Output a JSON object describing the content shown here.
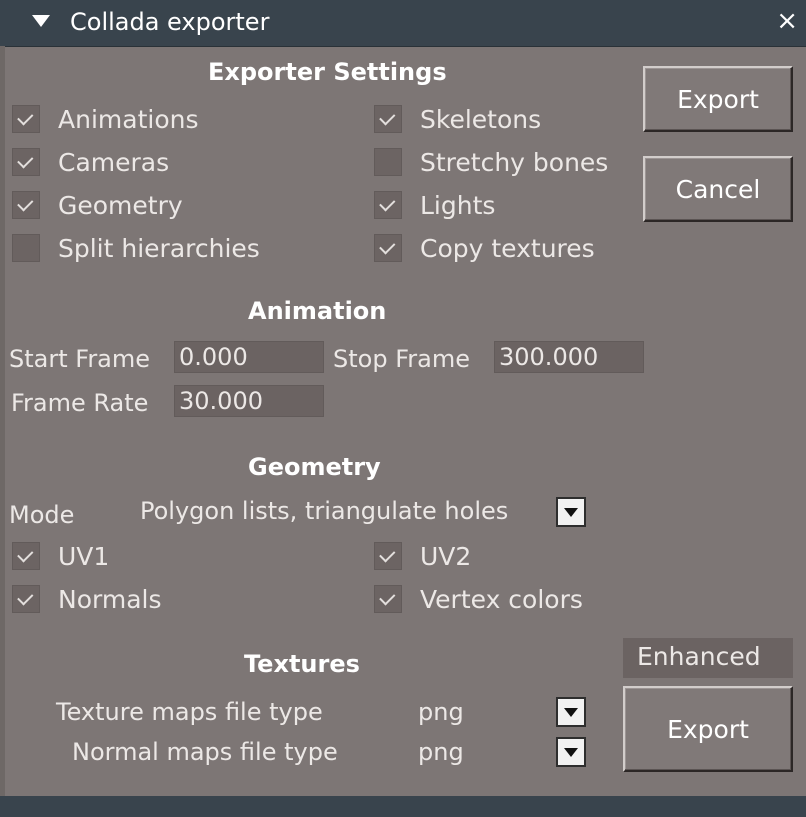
{
  "window": {
    "title": "Collada exporter",
    "close_glyph": "×"
  },
  "exporter_settings": {
    "heading": "Exporter Settings",
    "options": [
      {
        "label": "Animations",
        "checked": true
      },
      {
        "label": "Cameras",
        "checked": true
      },
      {
        "label": "Geometry",
        "checked": true
      },
      {
        "label": "Split hierarchies",
        "checked": false
      },
      {
        "label": "Skeletons",
        "checked": true
      },
      {
        "label": "Stretchy bones",
        "checked": false
      },
      {
        "label": "Lights",
        "checked": true
      },
      {
        "label": "Copy textures",
        "checked": true
      }
    ]
  },
  "buttons": {
    "export": "Export",
    "cancel": "Cancel",
    "enhanced_export": "Export"
  },
  "animation": {
    "heading": "Animation",
    "start_frame_label": "Start Frame",
    "start_frame_value": "0.000",
    "stop_frame_label": "Stop Frame",
    "stop_frame_value": "300.000",
    "frame_rate_label": "Frame Rate",
    "frame_rate_value": "30.000"
  },
  "geometry": {
    "heading": "Geometry",
    "mode_label": "Mode",
    "mode_value": "Polygon lists, triangulate holes",
    "options": [
      {
        "label": "UV1",
        "checked": true
      },
      {
        "label": "Normals",
        "checked": true
      },
      {
        "label": "UV2",
        "checked": true
      },
      {
        "label": "Vertex colors",
        "checked": true
      }
    ]
  },
  "textures": {
    "heading": "Textures",
    "texture_maps_label": "Texture maps file type",
    "texture_maps_value": "png",
    "normal_maps_label": "Normal maps file type",
    "normal_maps_value": "png"
  },
  "enhanced": {
    "label": "Enhanced"
  },
  "colors": {
    "titlebar": "#39444d",
    "panel_background": "#7d7675",
    "field_background": "#6b6362"
  }
}
